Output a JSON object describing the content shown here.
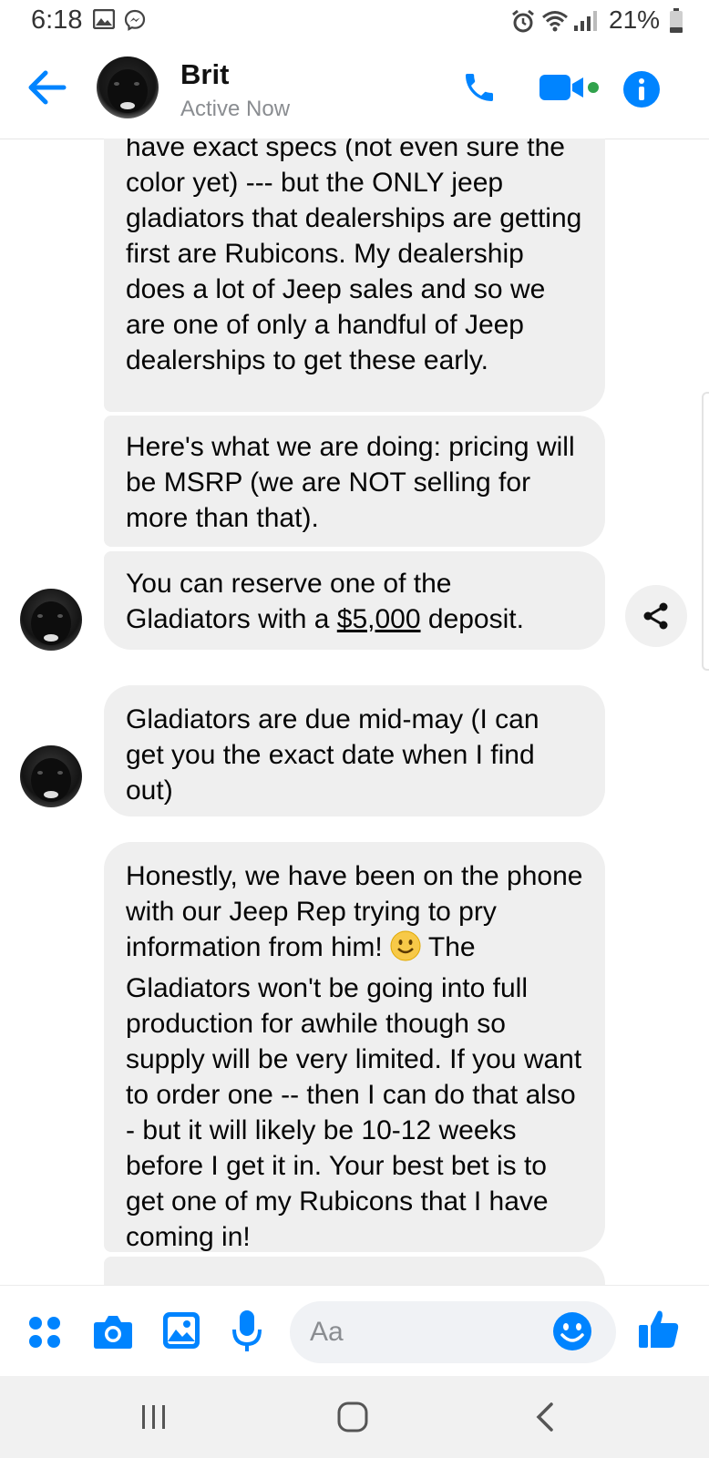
{
  "status_bar": {
    "time": "6:18",
    "battery_percent": "21%",
    "icons": [
      "image-icon",
      "messenger-icon",
      "alarm-icon",
      "wifi-icon",
      "signal-icon",
      "battery-icon"
    ]
  },
  "header": {
    "contact_name": "Brit",
    "contact_status": "Active Now",
    "accent_color": "#0084ff",
    "active_color": "#31a24c"
  },
  "messages": [
    {
      "text": "have exact specs (not even sure the color yet) --- but the ONLY jeep gladiators that dealerships are getting first are Rubicons. My dealership does a lot of Jeep sales and so we are one of only a handful of Jeep dealerships to get these early."
    },
    {
      "text": "Here's what we are doing: pricing will be MSRP (we are NOT selling for more than that)."
    },
    {
      "text_before": "You can reserve one of the Gladiators with a ",
      "link": "$5,000",
      "text_after": " deposit."
    },
    {
      "text": "Gladiators are due mid-may (I can get you the exact date when I find out)"
    },
    {
      "text_before": "Honestly, we have been on the phone with our Jeep Rep trying to pry information from him! ",
      "emoji": "smiley-emoji",
      "text_after": "  The Gladiators won't be going into full production for awhile though so supply will be very limited. If you want to order one -- then I can do that also - but it will likely be 10-12 weeks before I get it in. Your best bet is to get one of my Rubicons that I have coming in!"
    }
  ],
  "composer": {
    "placeholder": "Aa"
  },
  "colors": {
    "bubble": "#efefef",
    "accent": "#0084ff"
  }
}
